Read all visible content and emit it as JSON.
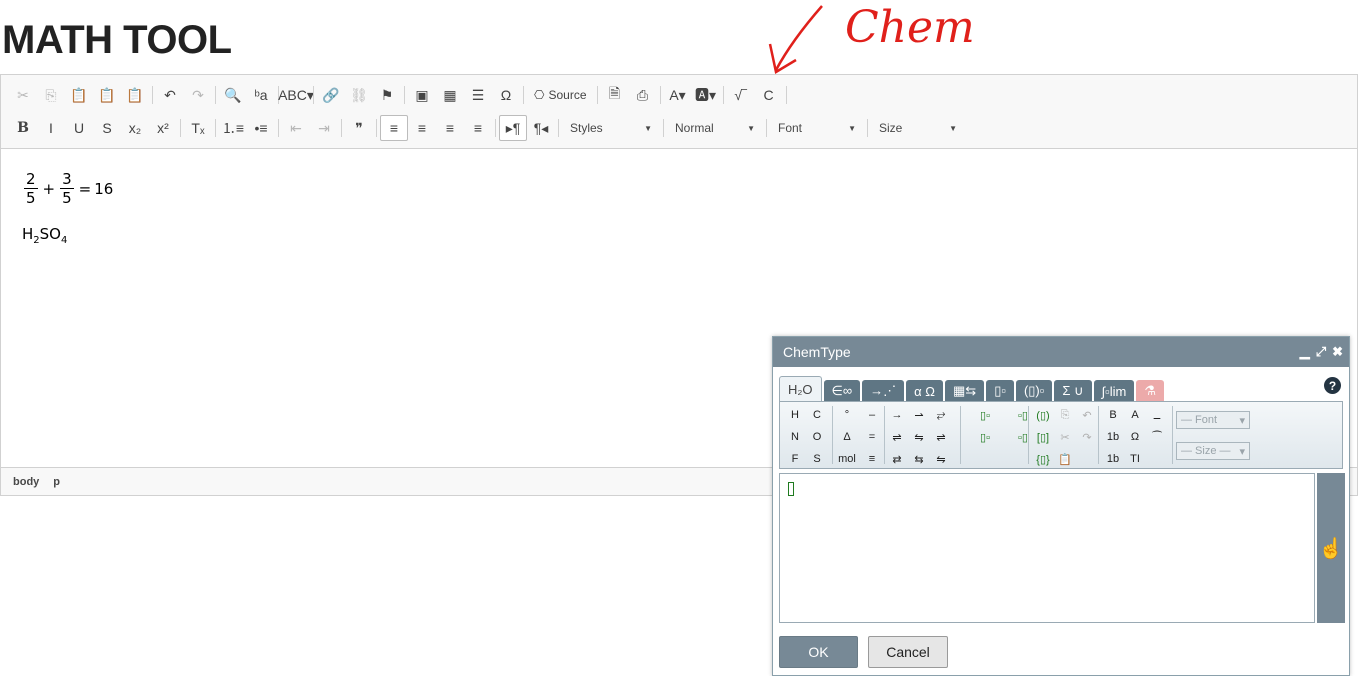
{
  "page": {
    "title": "MATH TOOL"
  },
  "annotation": {
    "text": "Chem",
    "color": "#e0201b"
  },
  "toolbar": {
    "row1": [
      {
        "name": "cut-icon",
        "glyph": "✂",
        "disabled": true
      },
      {
        "name": "copy-icon",
        "glyph": "⎘",
        "disabled": true
      },
      {
        "name": "paste-icon",
        "glyph": "📋",
        "disabled": false
      },
      {
        "name": "paste-text-icon",
        "glyph": "📋",
        "disabled": false
      },
      {
        "name": "paste-word-icon",
        "glyph": "📋",
        "disabled": false
      },
      {
        "sep": true
      },
      {
        "name": "undo-icon",
        "glyph": "↶",
        "disabled": false
      },
      {
        "name": "redo-icon",
        "glyph": "↷",
        "disabled": true
      },
      {
        "sep": true
      },
      {
        "name": "find-icon",
        "glyph": "🔍",
        "disabled": false
      },
      {
        "name": "replace-icon",
        "glyph": "ᵇa",
        "disabled": false
      },
      {
        "sep": true
      },
      {
        "name": "spellcheck-icon",
        "glyph": "ABC▾",
        "disabled": false
      },
      {
        "sep": true
      },
      {
        "name": "link-icon",
        "glyph": "🔗",
        "disabled": false
      },
      {
        "name": "unlink-icon",
        "glyph": "⛓",
        "disabled": true
      },
      {
        "name": "anchor-flag-icon",
        "glyph": "⚑",
        "disabled": false
      },
      {
        "sep": true
      },
      {
        "name": "image-icon",
        "glyph": "▣",
        "disabled": false
      },
      {
        "name": "table-icon",
        "glyph": "▦",
        "disabled": false
      },
      {
        "name": "horizontal-line-icon",
        "glyph": "☰",
        "disabled": false
      },
      {
        "name": "special-char-icon",
        "glyph": "Ω",
        "disabled": false
      },
      {
        "sep": true
      },
      {
        "name": "source-button",
        "glyph": "⎔",
        "label": "Source",
        "disabled": false
      },
      {
        "sep": true
      },
      {
        "name": "preview-icon",
        "glyph": "🗎",
        "disabled": false
      },
      {
        "name": "print-icon",
        "glyph": "⎙",
        "disabled": false
      },
      {
        "sep": true
      },
      {
        "name": "text-color-icon",
        "glyph": "A▾",
        "disabled": false
      },
      {
        "name": "bg-color-icon",
        "glyph": "🅰▾",
        "disabled": false
      },
      {
        "sep": true
      },
      {
        "name": "math-type-icon",
        "glyph": "√‾",
        "disabled": false
      },
      {
        "name": "chem-type-icon",
        "glyph": "C",
        "disabled": false
      },
      {
        "sep": true
      }
    ],
    "row2": [
      {
        "name": "bold-icon",
        "glyph": "B",
        "bold": true
      },
      {
        "name": "italic-icon",
        "glyph": "I"
      },
      {
        "name": "underline-icon",
        "glyph": "U"
      },
      {
        "name": "strikethrough-icon",
        "glyph": "S"
      },
      {
        "name": "subscript-icon",
        "glyph": "x₂"
      },
      {
        "name": "superscript-icon",
        "glyph": "x²"
      },
      {
        "sep": true
      },
      {
        "name": "remove-format-icon",
        "glyph": "Tₓ"
      },
      {
        "sep": true
      },
      {
        "name": "numbered-list-icon",
        "glyph": "⒈≡"
      },
      {
        "name": "bulleted-list-icon",
        "glyph": "•≡"
      },
      {
        "sep": true
      },
      {
        "name": "outdent-icon",
        "glyph": "⇤",
        "disabled": true
      },
      {
        "name": "indent-icon",
        "glyph": "⇥",
        "disabled": true
      },
      {
        "sep": true
      },
      {
        "name": "blockquote-icon",
        "glyph": "❞"
      },
      {
        "sep": true
      },
      {
        "name": "align-left-icon",
        "glyph": "≡",
        "active": true
      },
      {
        "name": "align-center-icon",
        "glyph": "≡"
      },
      {
        "name": "align-right-icon",
        "glyph": "≡"
      },
      {
        "name": "justify-icon",
        "glyph": "≡"
      },
      {
        "sep": true
      },
      {
        "name": "ltr-icon",
        "glyph": "▸¶",
        "active": true
      },
      {
        "name": "rtl-icon",
        "glyph": "¶◂"
      },
      {
        "sep": true
      }
    ],
    "combos": {
      "styles": "Styles",
      "format": "Normal",
      "font": "Font",
      "size": "Size"
    }
  },
  "content": {
    "eq1": {
      "num1": "2",
      "den1": "5",
      "op1": "+",
      "num2": "3",
      "den2": "5",
      "eq": "=",
      "result": "16"
    },
    "chem": {
      "h": "H",
      "h_sub": "2",
      "so": "SO",
      "o_sub": "4"
    }
  },
  "pathbar": {
    "items": [
      "body",
      "p"
    ]
  },
  "chemtype": {
    "title": "ChemType",
    "controls": {
      "minimize": "▁",
      "maximize": "⤢",
      "close": "✖"
    },
    "tabs": [
      {
        "label": "H₂O",
        "active": true
      },
      {
        "label": "∈∞"
      },
      {
        "label": "→⋰"
      },
      {
        "label": "α Ω"
      },
      {
        "label": "▦⇆"
      },
      {
        "label": "▯▫"
      },
      {
        "label": "(▯)▫"
      },
      {
        "label": "Σ ∪"
      },
      {
        "label": "∫▫lim"
      },
      {
        "label": "⚗",
        "red": true
      }
    ],
    "help": "?",
    "palette": {
      "elements": [
        "H",
        "C",
        "N",
        "O",
        "F",
        "S"
      ],
      "symbols": [
        "°",
        "–",
        "Δ",
        "=",
        "mol",
        "≡"
      ],
      "arrows": [
        "→",
        "⇀",
        "⥂",
        "⇌",
        "⇋",
        "⇌",
        "⇄",
        "⇆",
        "⇋"
      ],
      "templates": [
        "▯▫",
        "▫▯",
        "▯▫",
        "▫▯"
      ],
      "brackets": [
        "(▯)",
        "⎘",
        "↶",
        "[▯]",
        "✂",
        "↷",
        "{▯}",
        "📋",
        ""
      ],
      "format": [
        "B",
        "A",
        "ــ",
        "1b",
        "Ω",
        "⁀",
        "1b",
        "TI",
        ""
      ],
      "font_placeholder": "— Font",
      "size_placeholder": "— Size —"
    },
    "ok_label": "OK",
    "cancel_label": "Cancel",
    "hand_icon": "☝"
  }
}
